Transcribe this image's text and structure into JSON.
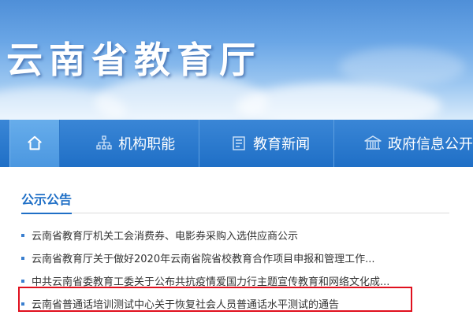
{
  "site": {
    "title": "云南省教育厅"
  },
  "nav": {
    "home_icon": "home-icon",
    "items": [
      {
        "label": "机构职能",
        "icon": "org-chart-icon"
      },
      {
        "label": "教育新闻",
        "icon": "document-icon"
      },
      {
        "label": "政府信息公开",
        "icon": "government-building-icon"
      }
    ]
  },
  "section": {
    "title": "公示公告"
  },
  "news": [
    "云南省教育厅机关工会消费券、电影券采购入选供应商公示",
    "云南省教育厅关于做好2020年云南省院省校教育合作项目申报和管理工作...",
    "中共云南省委教育工委关于公布共抗疫情爱国力行主题宣传教育和网络文化成...",
    "云南省普通话培训测试中心关于恢复社会人员普通话水平测试的通告"
  ],
  "colors": {
    "accent": "#1f6fc6",
    "highlight_border": "#e0101e"
  }
}
